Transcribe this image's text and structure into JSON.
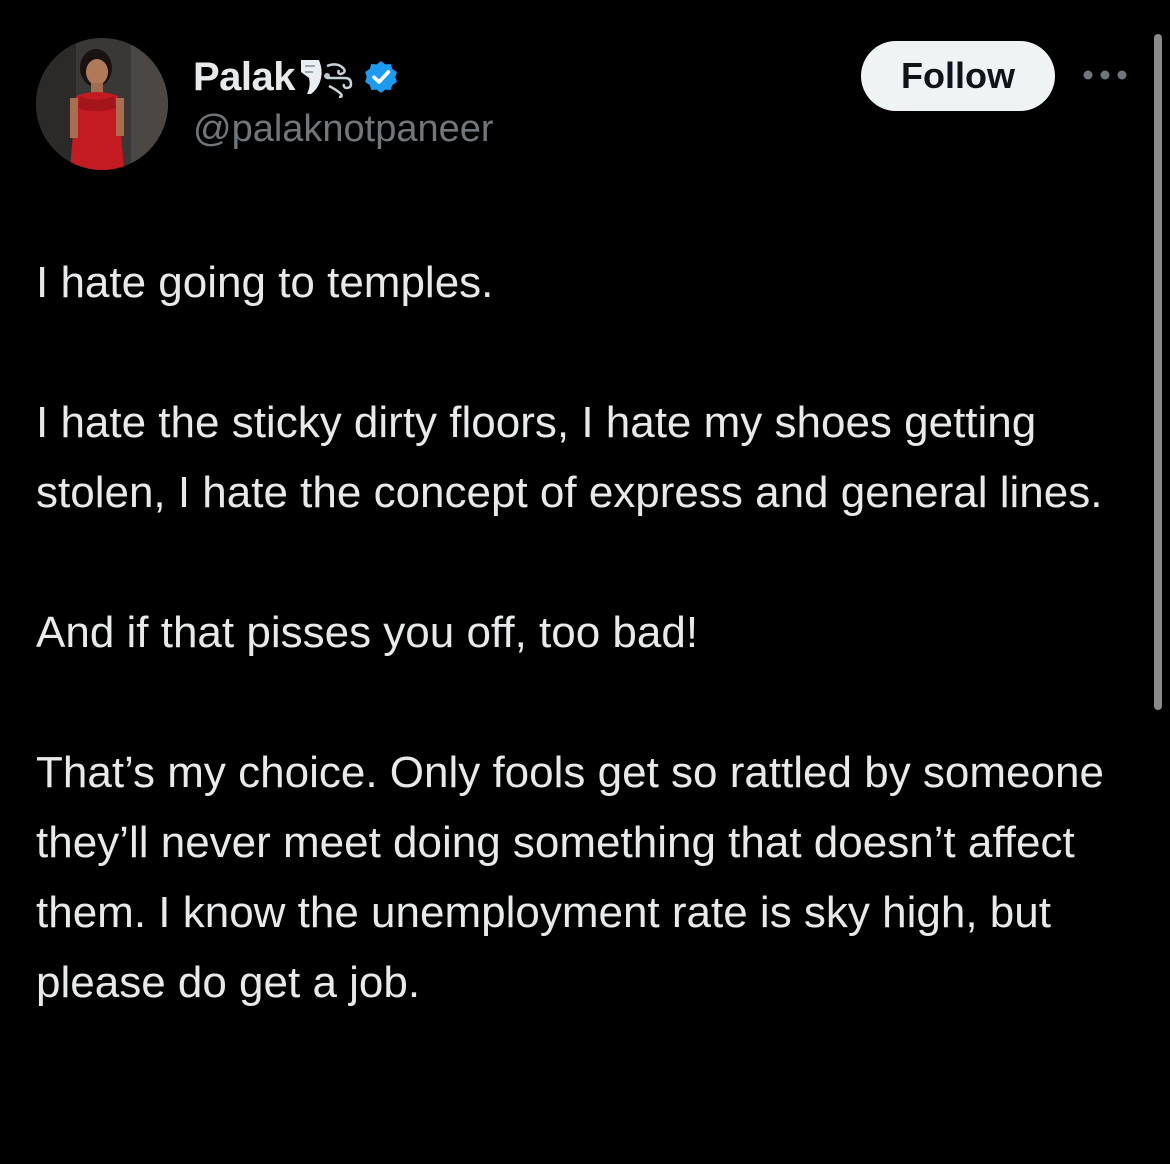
{
  "author": {
    "display_name": "Palak",
    "name_emoji": "wind-blowing-face-icon",
    "verified": true,
    "handle": "@palaknotpaneer"
  },
  "actions": {
    "follow_label": "Follow",
    "more_icon": "more-horizontal-icon"
  },
  "tweet": {
    "paragraphs": [
      "I hate going to temples.",
      "I hate the sticky dirty floors, I hate my shoes getting stolen, I hate the concept of express and general lines.",
      "And if that pisses you off, too bad!",
      "That’s my choice. Only fools get so rattled by someone they’ll never meet doing something that doesn’t affect them. I know the unemployment rate is sky high, but please do get a job."
    ]
  },
  "colors": {
    "background": "#000000",
    "text_primary": "#e7e9ea",
    "text_secondary": "#71767b",
    "verified_blue": "#1d9bf0",
    "follow_bg": "#eff3f4",
    "follow_text": "#0f1419"
  }
}
